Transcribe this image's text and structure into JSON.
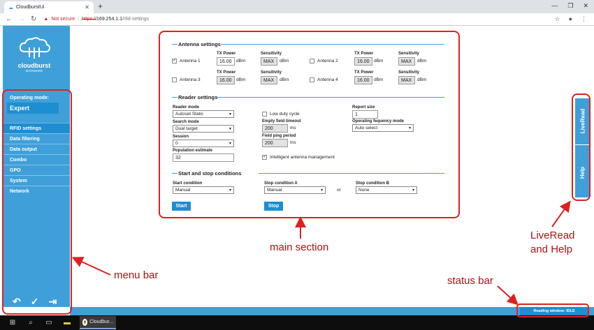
{
  "browser": {
    "tab_title": "CloudburstUi",
    "warn_text": "Not secure",
    "url_scheme": "https://",
    "url_host": "169.254.1.1",
    "url_path": "/rfid-settings"
  },
  "sidebar": {
    "logo_text": "cloudburst",
    "logo_sub": "DATAMARS",
    "opmode_label": "Operating mode:",
    "opmode_value": "Expert",
    "items": [
      {
        "label": "RFID settings"
      },
      {
        "label": "Data filtering"
      },
      {
        "label": "Data output"
      },
      {
        "label": "Combo"
      },
      {
        "label": "GPO"
      },
      {
        "label": "System"
      },
      {
        "label": "Network"
      }
    ]
  },
  "antenna": {
    "title": "Antenna settings",
    "tx_label": "TX Power",
    "sens_label": "Sensitivity",
    "unit": "dBm",
    "list": [
      {
        "name": "Antenna 1",
        "checked": true,
        "tx": "16.00",
        "sens": "MAX"
      },
      {
        "name": "Antenna 2",
        "checked": false,
        "tx": "16.00",
        "sens": "MAX"
      },
      {
        "name": "Antenna 3",
        "checked": false,
        "tx": "16.00",
        "sens": "MAX"
      },
      {
        "name": "Antenna 4",
        "checked": false,
        "tx": "16.00",
        "sens": "MAX"
      }
    ]
  },
  "reader": {
    "title": "Reader settings",
    "reader_mode_label": "Reader mode",
    "reader_mode": "Autoset Static",
    "search_mode_label": "Search mode",
    "search_mode": "Dual target",
    "session_label": "Session",
    "session": "0",
    "population_label": "Population estimate",
    "population": "32",
    "low_duty": "Low duty cycle",
    "empty_timeout_label": "Empty field timeout",
    "empty_timeout": "200",
    "field_ping_label": "Field ping period",
    "field_ping": "200",
    "ms": "ms",
    "intelligent": "Intelligent antenna management",
    "report_size_label": "Report size",
    "report_size": "1",
    "freq_mode_label": "Operating fequency mode",
    "freq_mode": "Auto select"
  },
  "startstop": {
    "title": "Start and stop conditions",
    "start_label": "Start condition",
    "start_value": "Manual",
    "stopA_label": "Stop condition A",
    "stopA_value": "Manual",
    "or": "or",
    "stopB_label": "Stop condition B",
    "stopB_value": "None",
    "start_btn": "Start",
    "stop_btn": "Stop"
  },
  "right_panel": {
    "liveread": "LiveRead",
    "help": "Help"
  },
  "status": "Reading window: IDLE",
  "taskbar": {
    "chrome_label": "Cloudbur..."
  },
  "annotations": {
    "main_section": "main section",
    "menu_bar": "menu bar",
    "liveread_help_1": "LiveRead",
    "liveread_help_2": "and Help",
    "status_bar": "status bar"
  },
  "colors": {
    "accent": "#3fa0d9",
    "accent_dark": "#1d8ed1",
    "annotation": "#e02020"
  }
}
